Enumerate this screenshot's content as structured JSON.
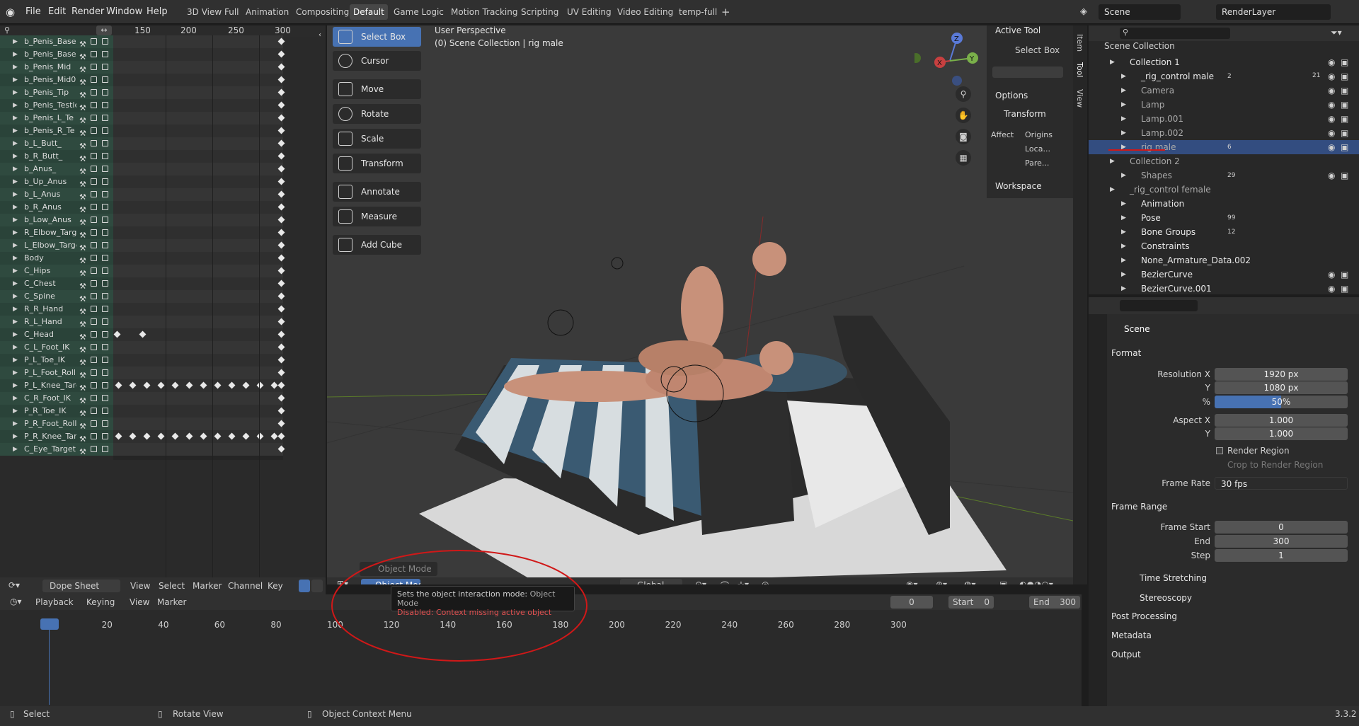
{
  "topbar": {
    "menus": [
      "File",
      "Edit",
      "Render",
      "Window",
      "Help"
    ],
    "workspaces": [
      "3D View Full",
      "Animation",
      "Compositing",
      "Default",
      "Game Logic",
      "Motion Tracking",
      "Scripting",
      "UV Editing",
      "Video Editing",
      "temp-full"
    ],
    "active_workspace": "Default",
    "scene": "Scene",
    "view_layer": "RenderLayer"
  },
  "dopesheet": {
    "ruler": [
      "150",
      "200",
      "250",
      "300"
    ],
    "channels": [
      "b_Penis_Base",
      "b_Penis_Base",
      "b_Penis_Mid",
      "b_Penis_Mid0",
      "b_Penis_Tip",
      "b_Penis_Testic",
      "b_Penis_L_Te",
      "b_Penis_R_Te",
      "b_L_Butt_",
      "b_R_Butt_",
      "b_Anus_",
      "b_Up_Anus",
      "b_L_Anus",
      "b_R_Anus",
      "b_Low_Anus",
      "R_Elbow_Targe",
      "L_Elbow_Targe",
      "Body",
      "C_Hips",
      "C_Chest",
      "C_Spine",
      "R_R_Hand",
      "R_L_Hand",
      "C_Head",
      "C_L_Foot_IK",
      "P_L_Toe_IK",
      "P_L_Foot_Roll",
      "P_L_Knee_Targ",
      "C_R_Foot_IK",
      "P_R_Toe_IK",
      "P_R_Foot_Roll",
      "P_R_Knee_Targ",
      "C_Eye_Target"
    ],
    "header": {
      "editor": "Dope Sheet",
      "menus": [
        "View",
        "Select",
        "Marker",
        "Channel",
        "Key"
      ]
    }
  },
  "viewport": {
    "perspective": "User Perspective",
    "collection": "(0) Scene Collection | rig male",
    "tools": [
      "Select Box",
      "Cursor",
      "Move",
      "Rotate",
      "Scale",
      "Transform",
      "Annotate",
      "Measure",
      "Add Cube"
    ],
    "mode_popup": "Object Mode",
    "mode_button": "Object Mode",
    "orientation": "Global",
    "tooltip_title": "Sets the object interaction mode:",
    "tooltip_value": "Object Mode",
    "tooltip_disabled": "Disabled: Context missing active object",
    "npanel": {
      "active_tool": "Active Tool",
      "select_box": "Select Box",
      "options": "Options",
      "transform": "Transform",
      "affect": "Affect",
      "origins": "Origins",
      "locations": "Loca...",
      "parents": "Pare...",
      "workspace": "Workspace"
    },
    "side_tabs": [
      "Item",
      "Tool",
      "View"
    ],
    "axes": {
      "z": "Z",
      "y": "Y",
      "x": "X"
    }
  },
  "outliner": {
    "title": "Scene Collection",
    "rows": [
      {
        "label": "Collection 1"
      },
      {
        "label": "_rig_control male",
        "count": "2"
      },
      {
        "label": "Camera"
      },
      {
        "label": "Lamp"
      },
      {
        "label": "Lamp.001"
      },
      {
        "label": "Lamp.002"
      },
      {
        "label": "rig male",
        "count": "6"
      },
      {
        "label": "Collection 2"
      },
      {
        "label": "Shapes",
        "count": "29"
      },
      {
        "label": "_rig_control female"
      },
      {
        "label": "Animation"
      },
      {
        "label": "Pose",
        "count": "99"
      },
      {
        "label": "Bone Groups",
        "count": "12"
      },
      {
        "label": "Constraints"
      },
      {
        "label": "None_Armature_Data.002"
      },
      {
        "label": "BezierCurve"
      },
      {
        "label": "BezierCurve.001"
      }
    ],
    "badge_21": "21"
  },
  "properties": {
    "context": "Scene",
    "format": "Format",
    "resolution_x_label": "Resolution X",
    "resolution_x": "1920 px",
    "y_label": "Y",
    "resolution_y": "1080 px",
    "percent_label": "%",
    "percent": "50%",
    "percent_value": 0.5,
    "aspect_x_label": "Aspect X",
    "aspect_x": "1.000",
    "aspect_y": "1.000",
    "render_region": "Render Region",
    "crop": "Crop to Render Region",
    "frame_rate_label": "Frame Rate",
    "frame_rate": "30 fps",
    "frame_range": "Frame Range",
    "frame_start_label": "Frame Start",
    "frame_start": "0",
    "end_label": "End",
    "frame_end": "300",
    "step_label": "Step",
    "step": "1",
    "time_stretching": "Time Stretching",
    "stereoscopy": "Stereoscopy",
    "post_processing": "Post Processing",
    "metadata": "Metadata",
    "output": "Output"
  },
  "timeline": {
    "menus": [
      "Playback",
      "Keying",
      "View",
      "Marker"
    ],
    "current_frame": "0",
    "start_label": "Start",
    "start": "0",
    "end_label": "End",
    "end": "300",
    "ruler": [
      "0",
      "20",
      "40",
      "60",
      "80",
      "100",
      "120",
      "140",
      "160",
      "180",
      "200",
      "220",
      "240",
      "260",
      "280",
      "300"
    ]
  },
  "status": {
    "select": "Select",
    "rotate": "Rotate View",
    "context": "Object Context Menu",
    "version": "3.3.2"
  }
}
